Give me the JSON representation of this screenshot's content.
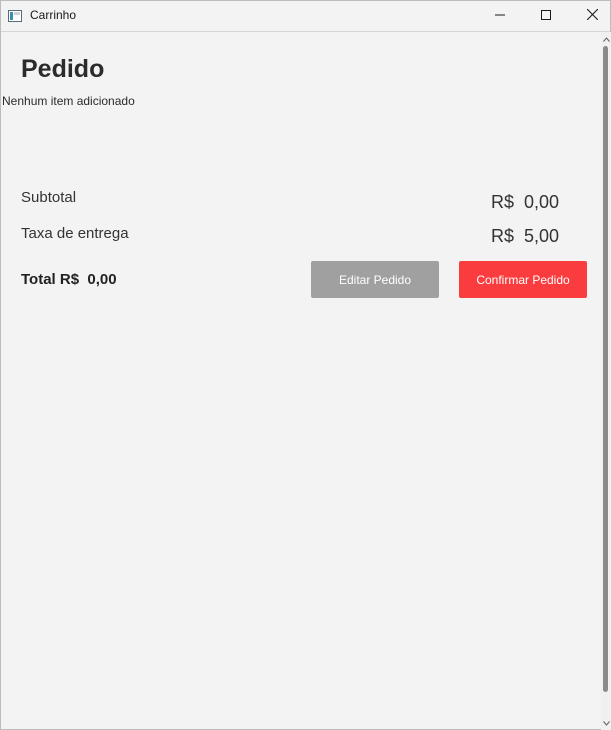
{
  "window": {
    "title": "Carrinho",
    "controls": {
      "minimize": "minimize-icon",
      "maximize": "maximize-icon",
      "close": "close-icon"
    }
  },
  "order": {
    "title": "Pedido",
    "empty_message": "Nenhum item adicionado",
    "subtotal_label": "Subtotal",
    "subtotal_value": "R$  0,00",
    "fee_label": "Taxa de entrega",
    "fee_value": "R$  5,00",
    "total_text": "Total R$  0,00"
  },
  "buttons": {
    "edit_label": "Editar Pedido",
    "confirm_label": "Confirmar Pedido"
  },
  "colors": {
    "background": "#f3f3f3",
    "edit_button": "#a0a0a0",
    "confirm_button": "#fa3c3f"
  }
}
